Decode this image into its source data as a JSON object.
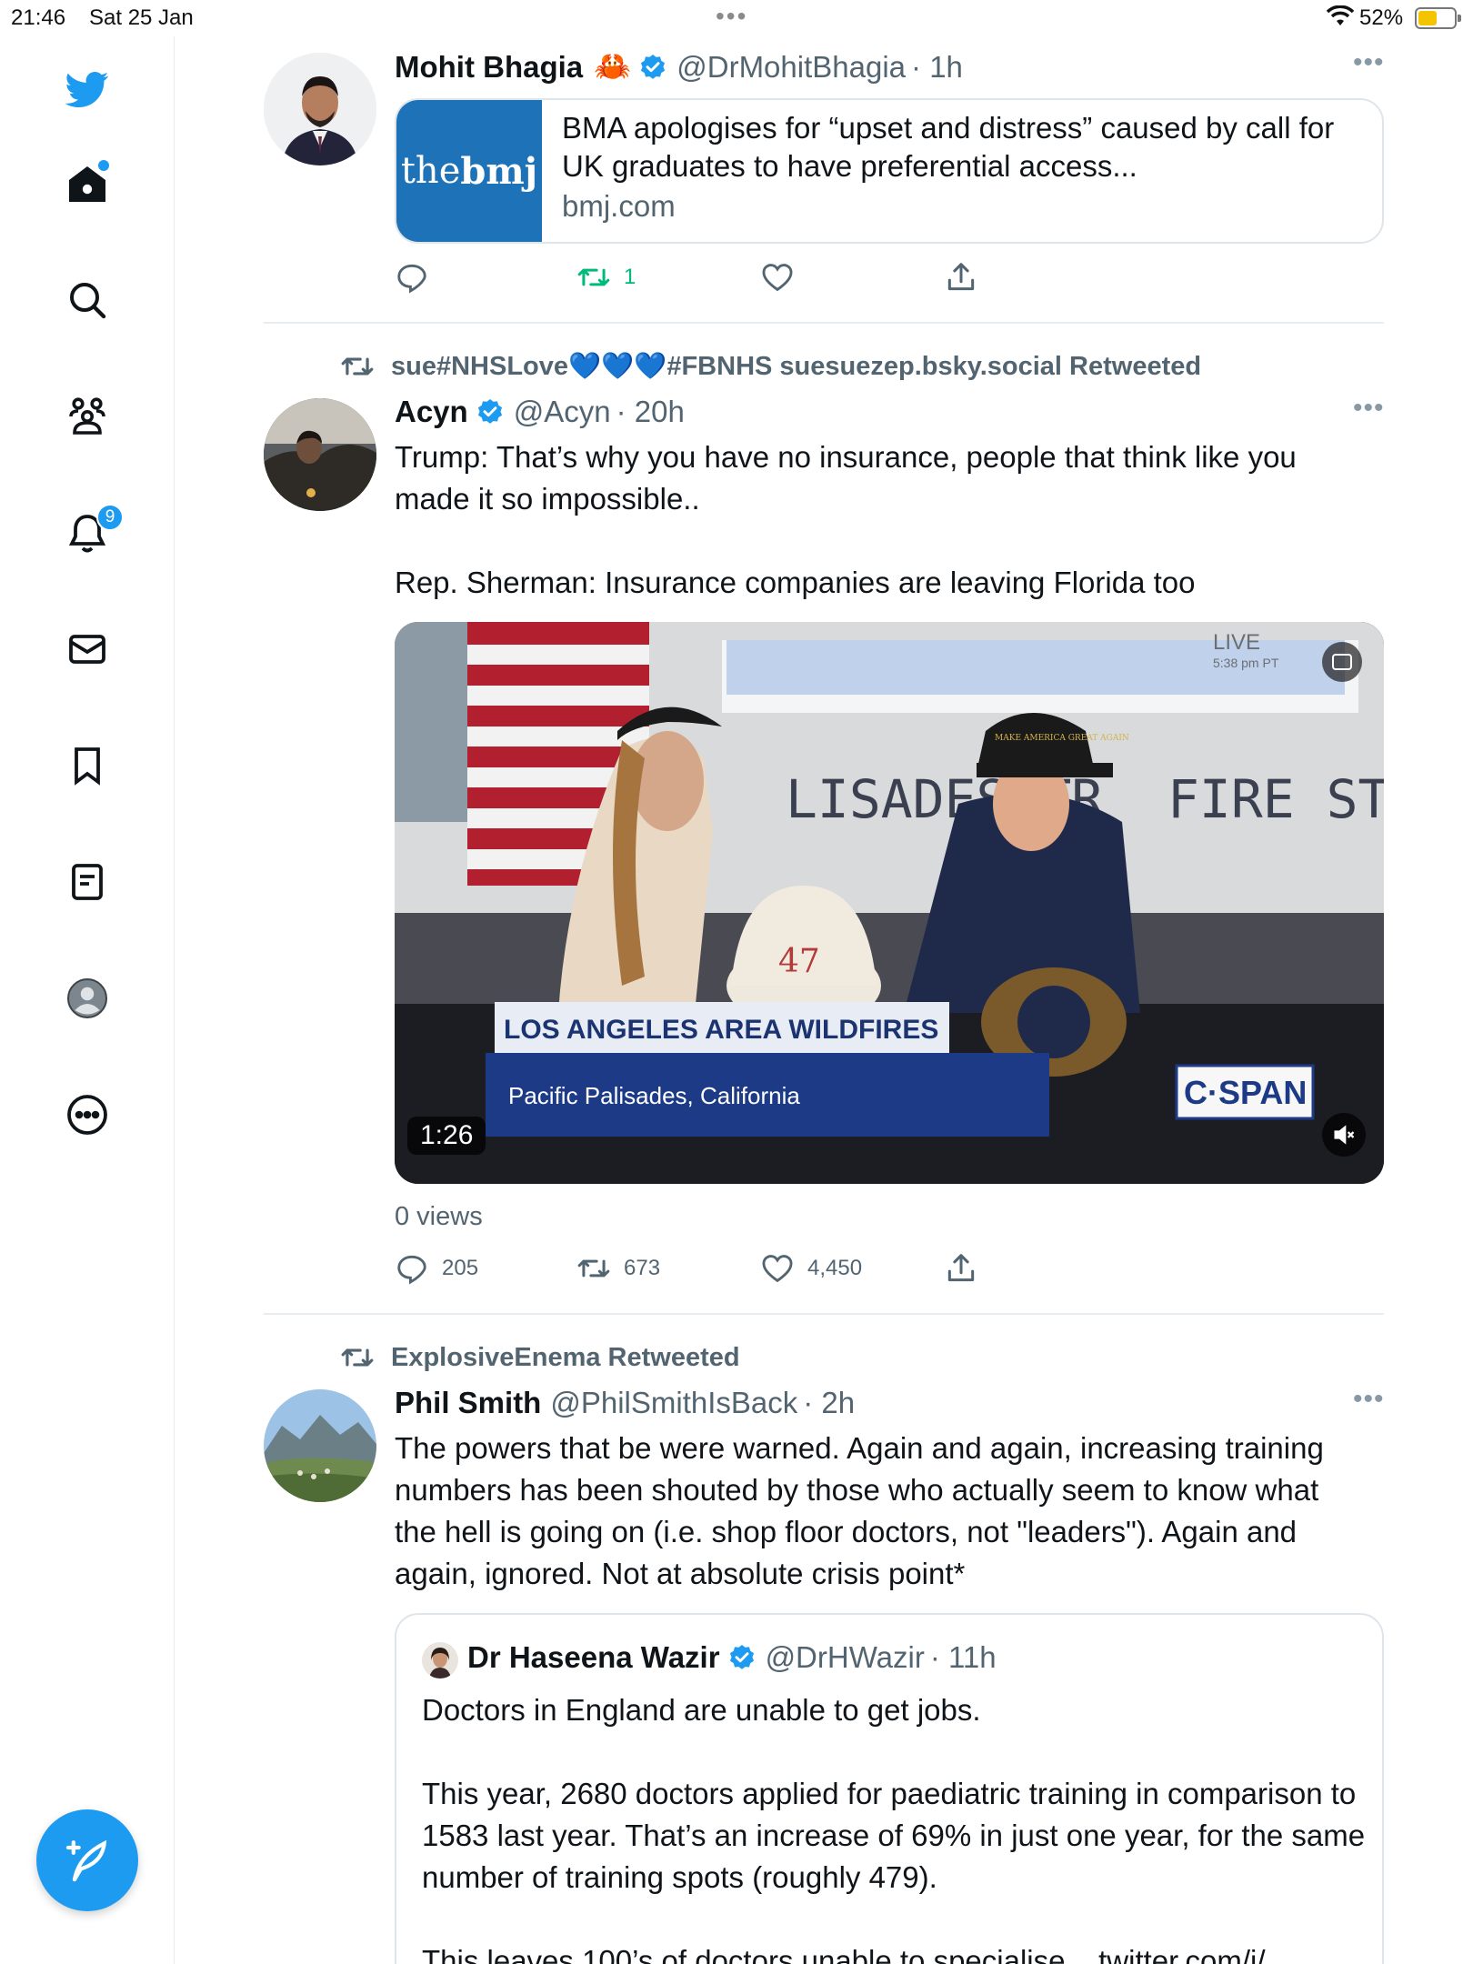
{
  "status_bar": {
    "time": "21:46",
    "date": "Sat 25 Jan",
    "battery_pct": "52%",
    "battery_level": 0.52,
    "battery_color": "#f5c400"
  },
  "sidebar": {
    "items": [
      {
        "name": "home-icon",
        "badge": ""
      },
      {
        "name": "search-icon",
        "badge": ""
      },
      {
        "name": "communities-icon",
        "badge": ""
      },
      {
        "name": "notifications-bell-icon",
        "badge": "9"
      },
      {
        "name": "messages-envelope-icon",
        "badge": ""
      },
      {
        "name": "bookmarks-icon",
        "badge": ""
      },
      {
        "name": "lists-icon",
        "badge": ""
      },
      {
        "name": "profile-icon",
        "badge": ""
      },
      {
        "name": "more-options-icon",
        "badge": ""
      }
    ],
    "accent": "#1d9bf0"
  },
  "tweets": [
    {
      "author": "Mohit Bhagia",
      "emoji": "🦀",
      "handle": "@DrMohitBhagia",
      "time": "· 1h",
      "card": {
        "thumb_prefix": "the",
        "thumb_bold": "bmj",
        "title": "BMA apologises for “upset and distress” caused by call for UK graduates to have preferential access...",
        "domain": "bmj.com"
      },
      "stats": {
        "replies": "",
        "retweets": "1",
        "likes": "",
        "share": ""
      }
    },
    {
      "retweeted_by": "sue#NHSLove💙💙💙#FBNHS suesuezep.bsky.social Retweeted",
      "author": "Acyn",
      "handle": "@Acyn",
      "time": "· 20h",
      "text": "Trump: That’s why you have no insurance, people that think like you made it so impossible..\n\nRep. Sherman: Insurance companies are leaving Florida too",
      "video": {
        "duration": "1:26",
        "live_label": "LIVE",
        "live_time": "5:38 pm PT",
        "banner_top": "LOS ANGELES AREA WILDFIRES",
        "banner_bottom": "Pacific Palisades, California",
        "network": "C·SPAN",
        "sign_left": "LISADESSTR",
        "sign_right": "FIRE STATIO",
        "helmet_number": "47",
        "cap_text": "MAKE AMERICA GREAT AGAIN",
        "cc_label": "CC",
        "mute_label": "🔇"
      },
      "views": "0 views",
      "stats": {
        "replies": "205",
        "retweets": "673",
        "likes": "4,450",
        "share": ""
      }
    },
    {
      "retweeted_by": "ExplosiveEnema Retweeted",
      "author": "Phil Smith",
      "handle": "@PhilSmithIsBack",
      "time": "· 2h",
      "text": "The powers that be were warned. Again and again, increasing training numbers has been shouted by those who actually seem to know what the hell is going on (i.e. shop floor doctors, not \"leaders\"). Again and again, ignored. Not at absolute crisis point*",
      "quote": {
        "author": "Dr Haseena Wazir",
        "handle": "@DrHWazir",
        "time": "· 11h",
        "text": "Doctors in England are unable to get jobs.\n\nThis year, 2680 doctors applied for paediatric training in comparison to 1583 last year. That’s an increase of 69% in just one year, for the same number of training spots (roughly 479).\n\nThis leaves 100’s of doctors unable to specialise... twitter.com/i/"
      }
    }
  ],
  "colors": {
    "retweet_green": "#00ba7c",
    "muted_text": "#536471",
    "bmj_blue": "#1e72b8"
  }
}
